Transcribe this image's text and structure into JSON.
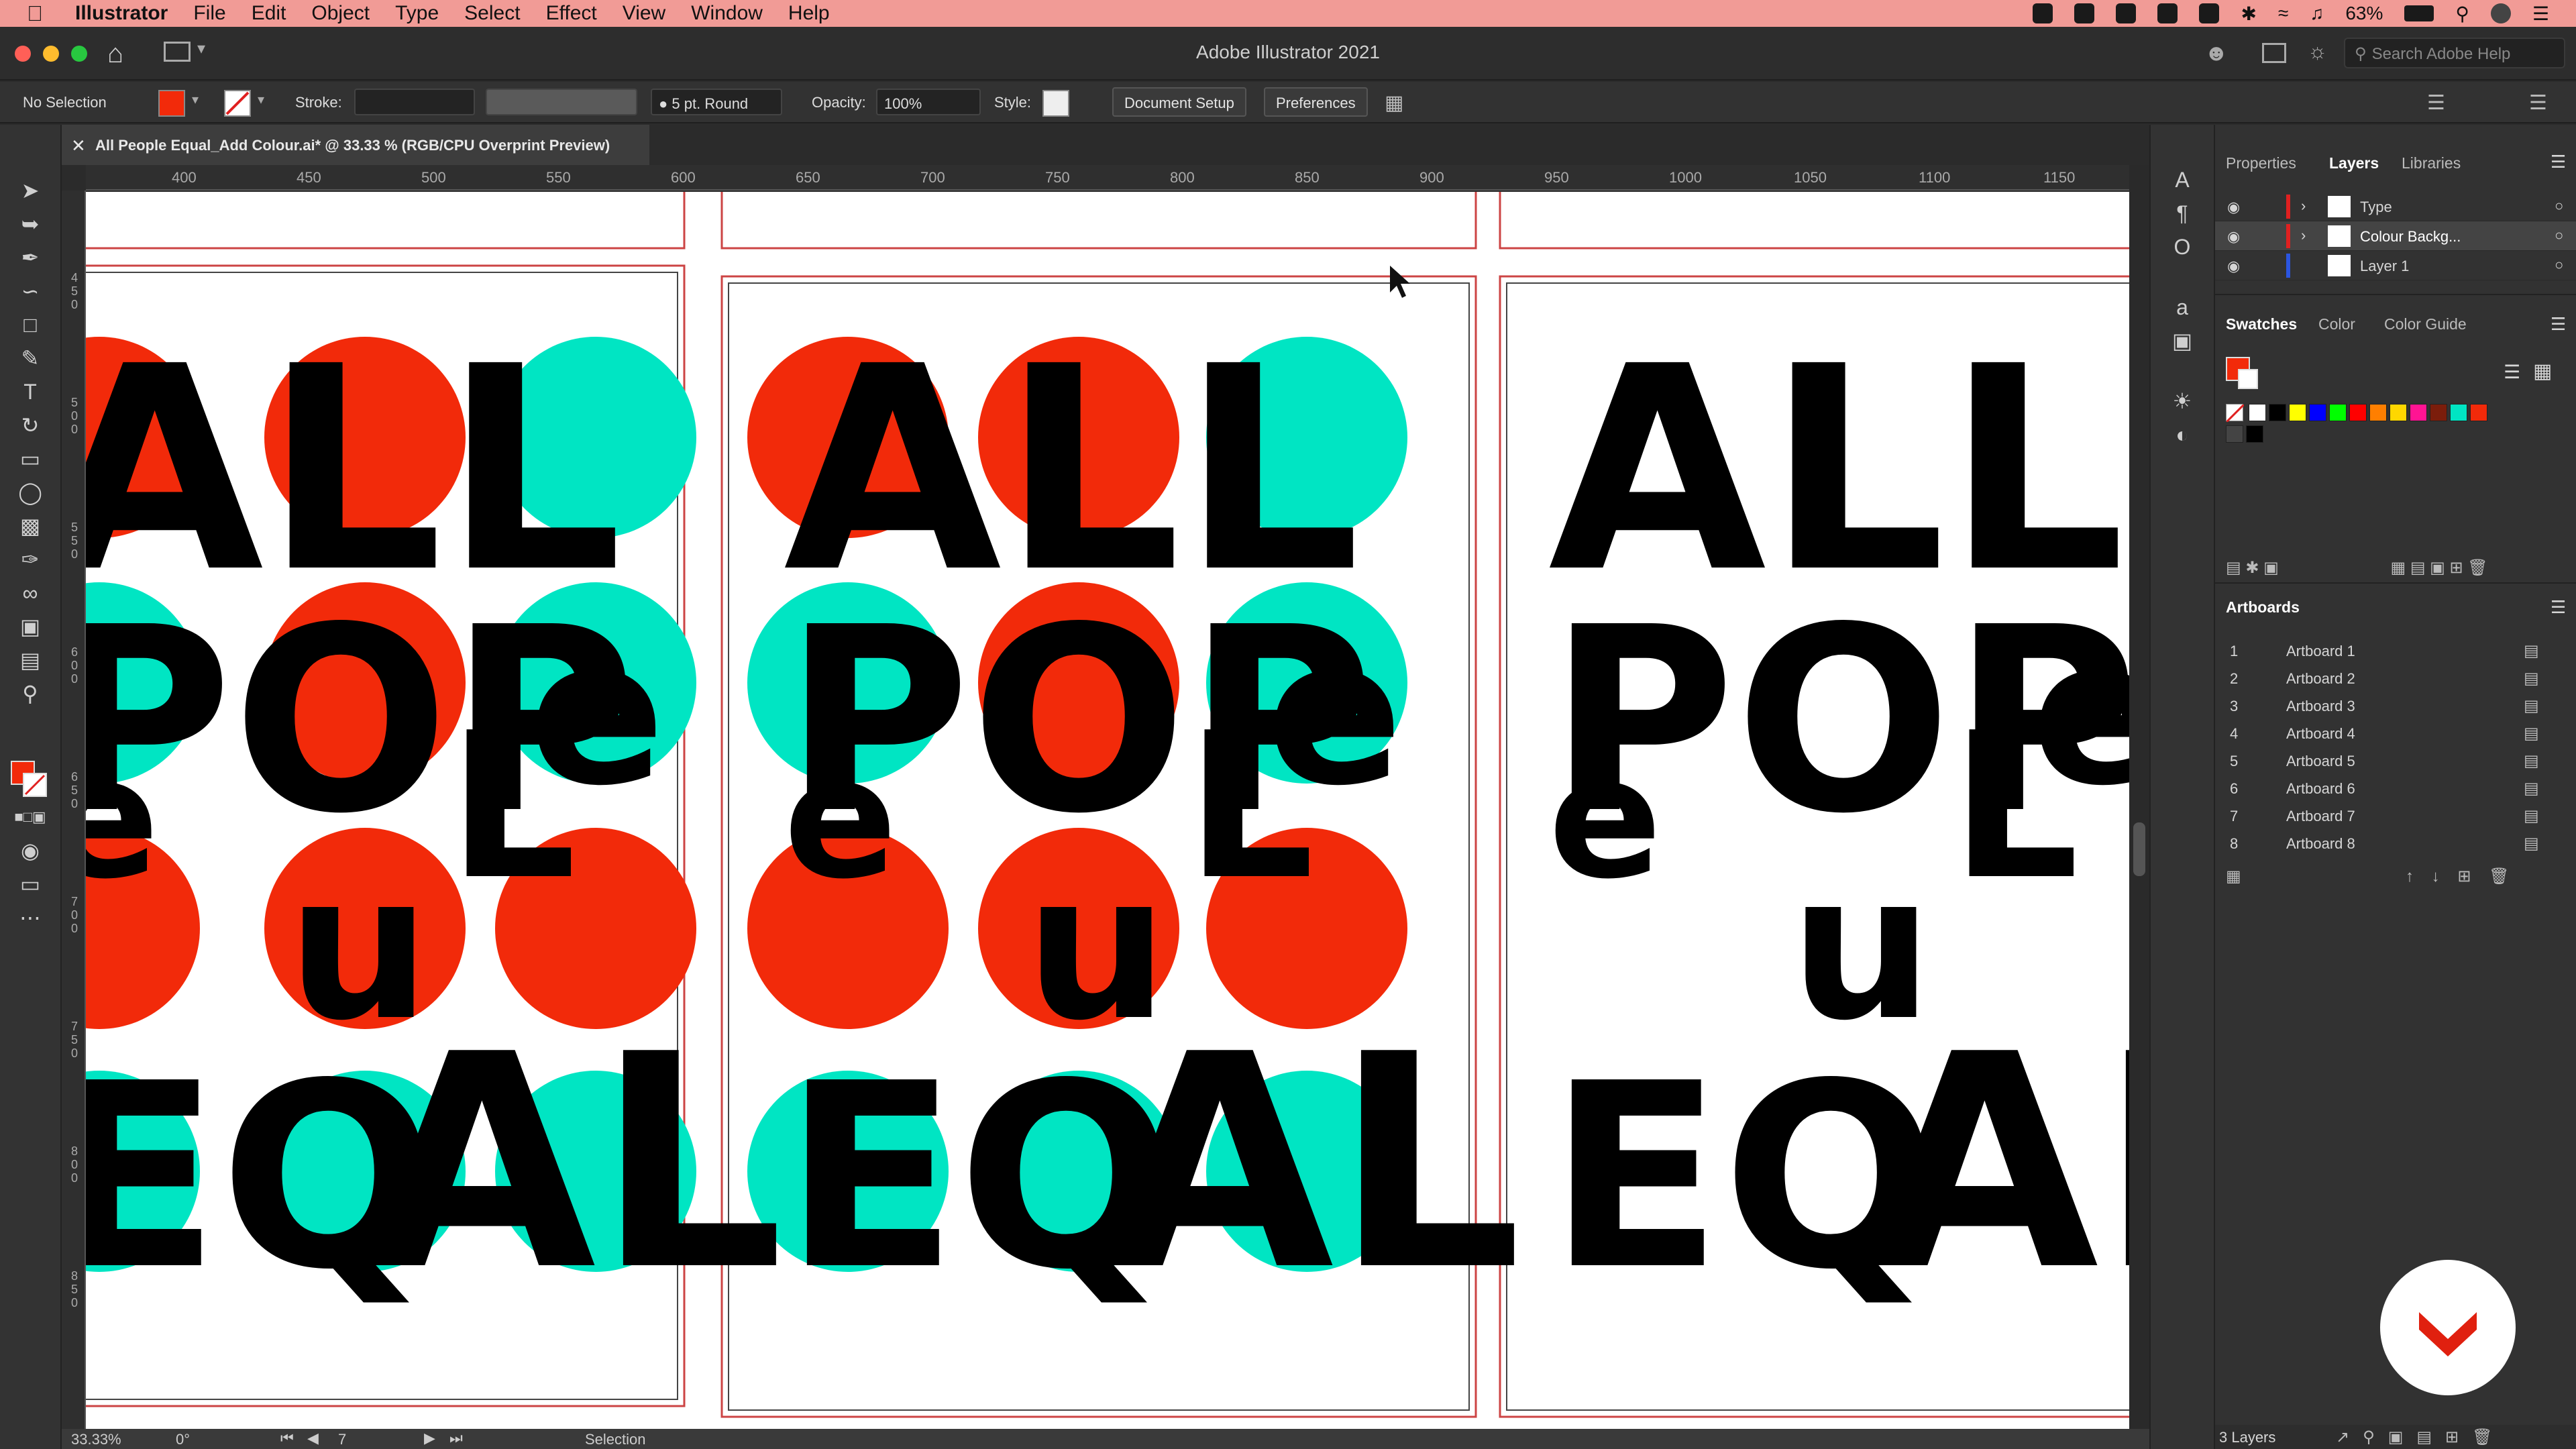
{
  "menubar": {
    "app_name": "Illustrator",
    "items": [
      "File",
      "Edit",
      "Object",
      "Type",
      "Select",
      "Effect",
      "View",
      "Window",
      "Help"
    ],
    "battery": "63%"
  },
  "titlebar": {
    "title": "Adobe Illustrator 2021",
    "search_placeholder": "Search Adobe Help"
  },
  "control_bar": {
    "selection": "No Selection",
    "stroke_label": "Stroke:",
    "brush": "5 pt. Round",
    "opacity_label": "Opacity:",
    "opacity_value": "100%",
    "style_label": "Style:",
    "document_setup": "Document Setup",
    "preferences": "Preferences"
  },
  "document": {
    "tab_title": "All People Equal_Add Colour.ai* @ 33.33 % (RGB/CPU Overprint Preview)"
  },
  "ruler": {
    "h_ticks": [
      "400",
      "450",
      "500",
      "550",
      "600",
      "650",
      "700",
      "750",
      "800",
      "850",
      "900",
      "950",
      "1000",
      "1050",
      "1100",
      "1150"
    ],
    "v_ticks": [
      "450",
      "500",
      "550",
      "600",
      "650",
      "700",
      "750",
      "800",
      "850"
    ]
  },
  "artwork": {
    "line1": "ALL",
    "line2a": "POP",
    "line2b": "e",
    "line3a": "e",
    "line3b": "L",
    "line3c": "u",
    "line4a": "EQ",
    "line4b": "AL",
    "red": "#f22a0a",
    "teal": "#00e5c3"
  },
  "status_bar": {
    "zoom": "33.33%",
    "rotation": "0°",
    "artboard": "7",
    "tool": "Selection"
  },
  "panels": {
    "top_tabs": [
      "Properties",
      "Layers",
      "Libraries"
    ],
    "layers": [
      {
        "name": "Type",
        "color": "#e02020"
      },
      {
        "name": "Colour Backg...",
        "color": "#e02020"
      },
      {
        "name": "Layer 1",
        "color": "#2b55e0"
      }
    ],
    "swatch_tabs": [
      "Swatches",
      "Color",
      "Color Guide"
    ],
    "swatch_colors": [
      "#ffffff",
      "#000000",
      "#ffff00",
      "#0000ff",
      "#00ff00",
      "#ff0000",
      "#ff7f00",
      "#ffd700",
      "#ff1493",
      "#7b1d0b",
      "#00e5c3",
      "#f22a0a"
    ],
    "artboards_title": "Artboards",
    "artboards": [
      {
        "num": "1",
        "name": "Artboard 1"
      },
      {
        "num": "2",
        "name": "Artboard 2"
      },
      {
        "num": "3",
        "name": "Artboard 3"
      },
      {
        "num": "4",
        "name": "Artboard 4"
      },
      {
        "num": "5",
        "name": "Artboard 5"
      },
      {
        "num": "6",
        "name": "Artboard 6"
      },
      {
        "num": "7",
        "name": "Artboard 7"
      },
      {
        "num": "8",
        "name": "Artboard 8"
      }
    ],
    "layers_count": "3 Layers"
  }
}
